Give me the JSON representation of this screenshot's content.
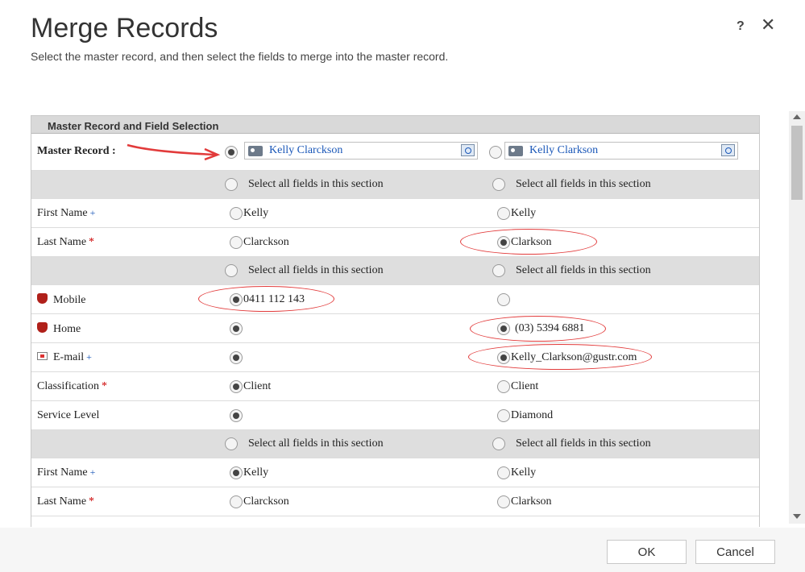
{
  "dialog": {
    "title": "Merge Records",
    "subtitle": "Select the master record, and then select the fields to merge into the master record.",
    "help_label": "?",
    "close_label": "✕"
  },
  "grid": {
    "header": "Master Record and Field Selection",
    "master_label": "Master Record :",
    "record1_name": "Kelly Clarckson",
    "record2_name": "Kelly Clarkson",
    "select_all_label": "Select all fields in this section",
    "sections": [
      {
        "rows": [
          {
            "label": "First Name",
            "marker": "+",
            "left": "Kelly",
            "right": "Kelly"
          },
          {
            "label": "Last Name",
            "marker": "*",
            "left": "Clarckson",
            "right": "Clarkson"
          }
        ]
      },
      {
        "rows": [
          {
            "label": "Mobile",
            "left": "0411 112 143",
            "right": ""
          },
          {
            "label": "Home",
            "left": "",
            "right": "(03) 5394 6881"
          },
          {
            "label": "E-mail",
            "marker": "+",
            "left": "",
            "right": "Kelly_Clarkson@gustr.com"
          },
          {
            "label": "Classification",
            "marker": "*",
            "left": "Client",
            "right": "Client"
          },
          {
            "label": "Service Level",
            "left": "",
            "right": "Diamond"
          }
        ]
      },
      {
        "rows": [
          {
            "label": "First Name",
            "marker": "+",
            "left": "Kelly",
            "right": "Kelly"
          },
          {
            "label": "Last Name",
            "marker": "*",
            "left": "Clarckson",
            "right": "Clarkson"
          }
        ]
      }
    ]
  },
  "footer": {
    "ok_label": "OK",
    "cancel_label": "Cancel"
  },
  "colors": {
    "annotation": "#e23b3b",
    "link": "#1a57b8",
    "required": "#cc0000"
  }
}
